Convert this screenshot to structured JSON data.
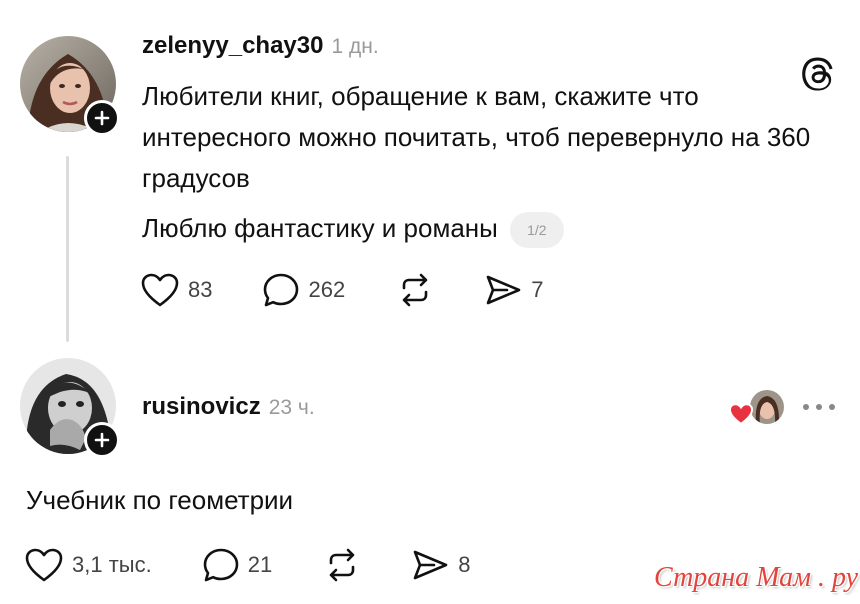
{
  "post": {
    "username": "zelenyy_chay30",
    "time": "1 дн.",
    "text": "Любители книг, обращение к вам, скажите что интересного можно почитать, чтоб перевернуло на 360 градусов",
    "subtext": "Люблю фантастику и романы",
    "pager": "1/2",
    "likes": "83",
    "replies": "262",
    "shares": "7",
    "icon": "threads-logo-icon"
  },
  "reply": {
    "username": "rusinovicz",
    "time": "23 ч.",
    "text": "Учебник по геометрии",
    "likes": "3,1 тыс.",
    "replies": "21",
    "shares": "8"
  },
  "watermark": "Страна Мам . ру",
  "colors": {
    "text": "#111111",
    "muted": "#9a9a9a",
    "like_heart": "#e8323f",
    "watermark": "#e2443d"
  }
}
